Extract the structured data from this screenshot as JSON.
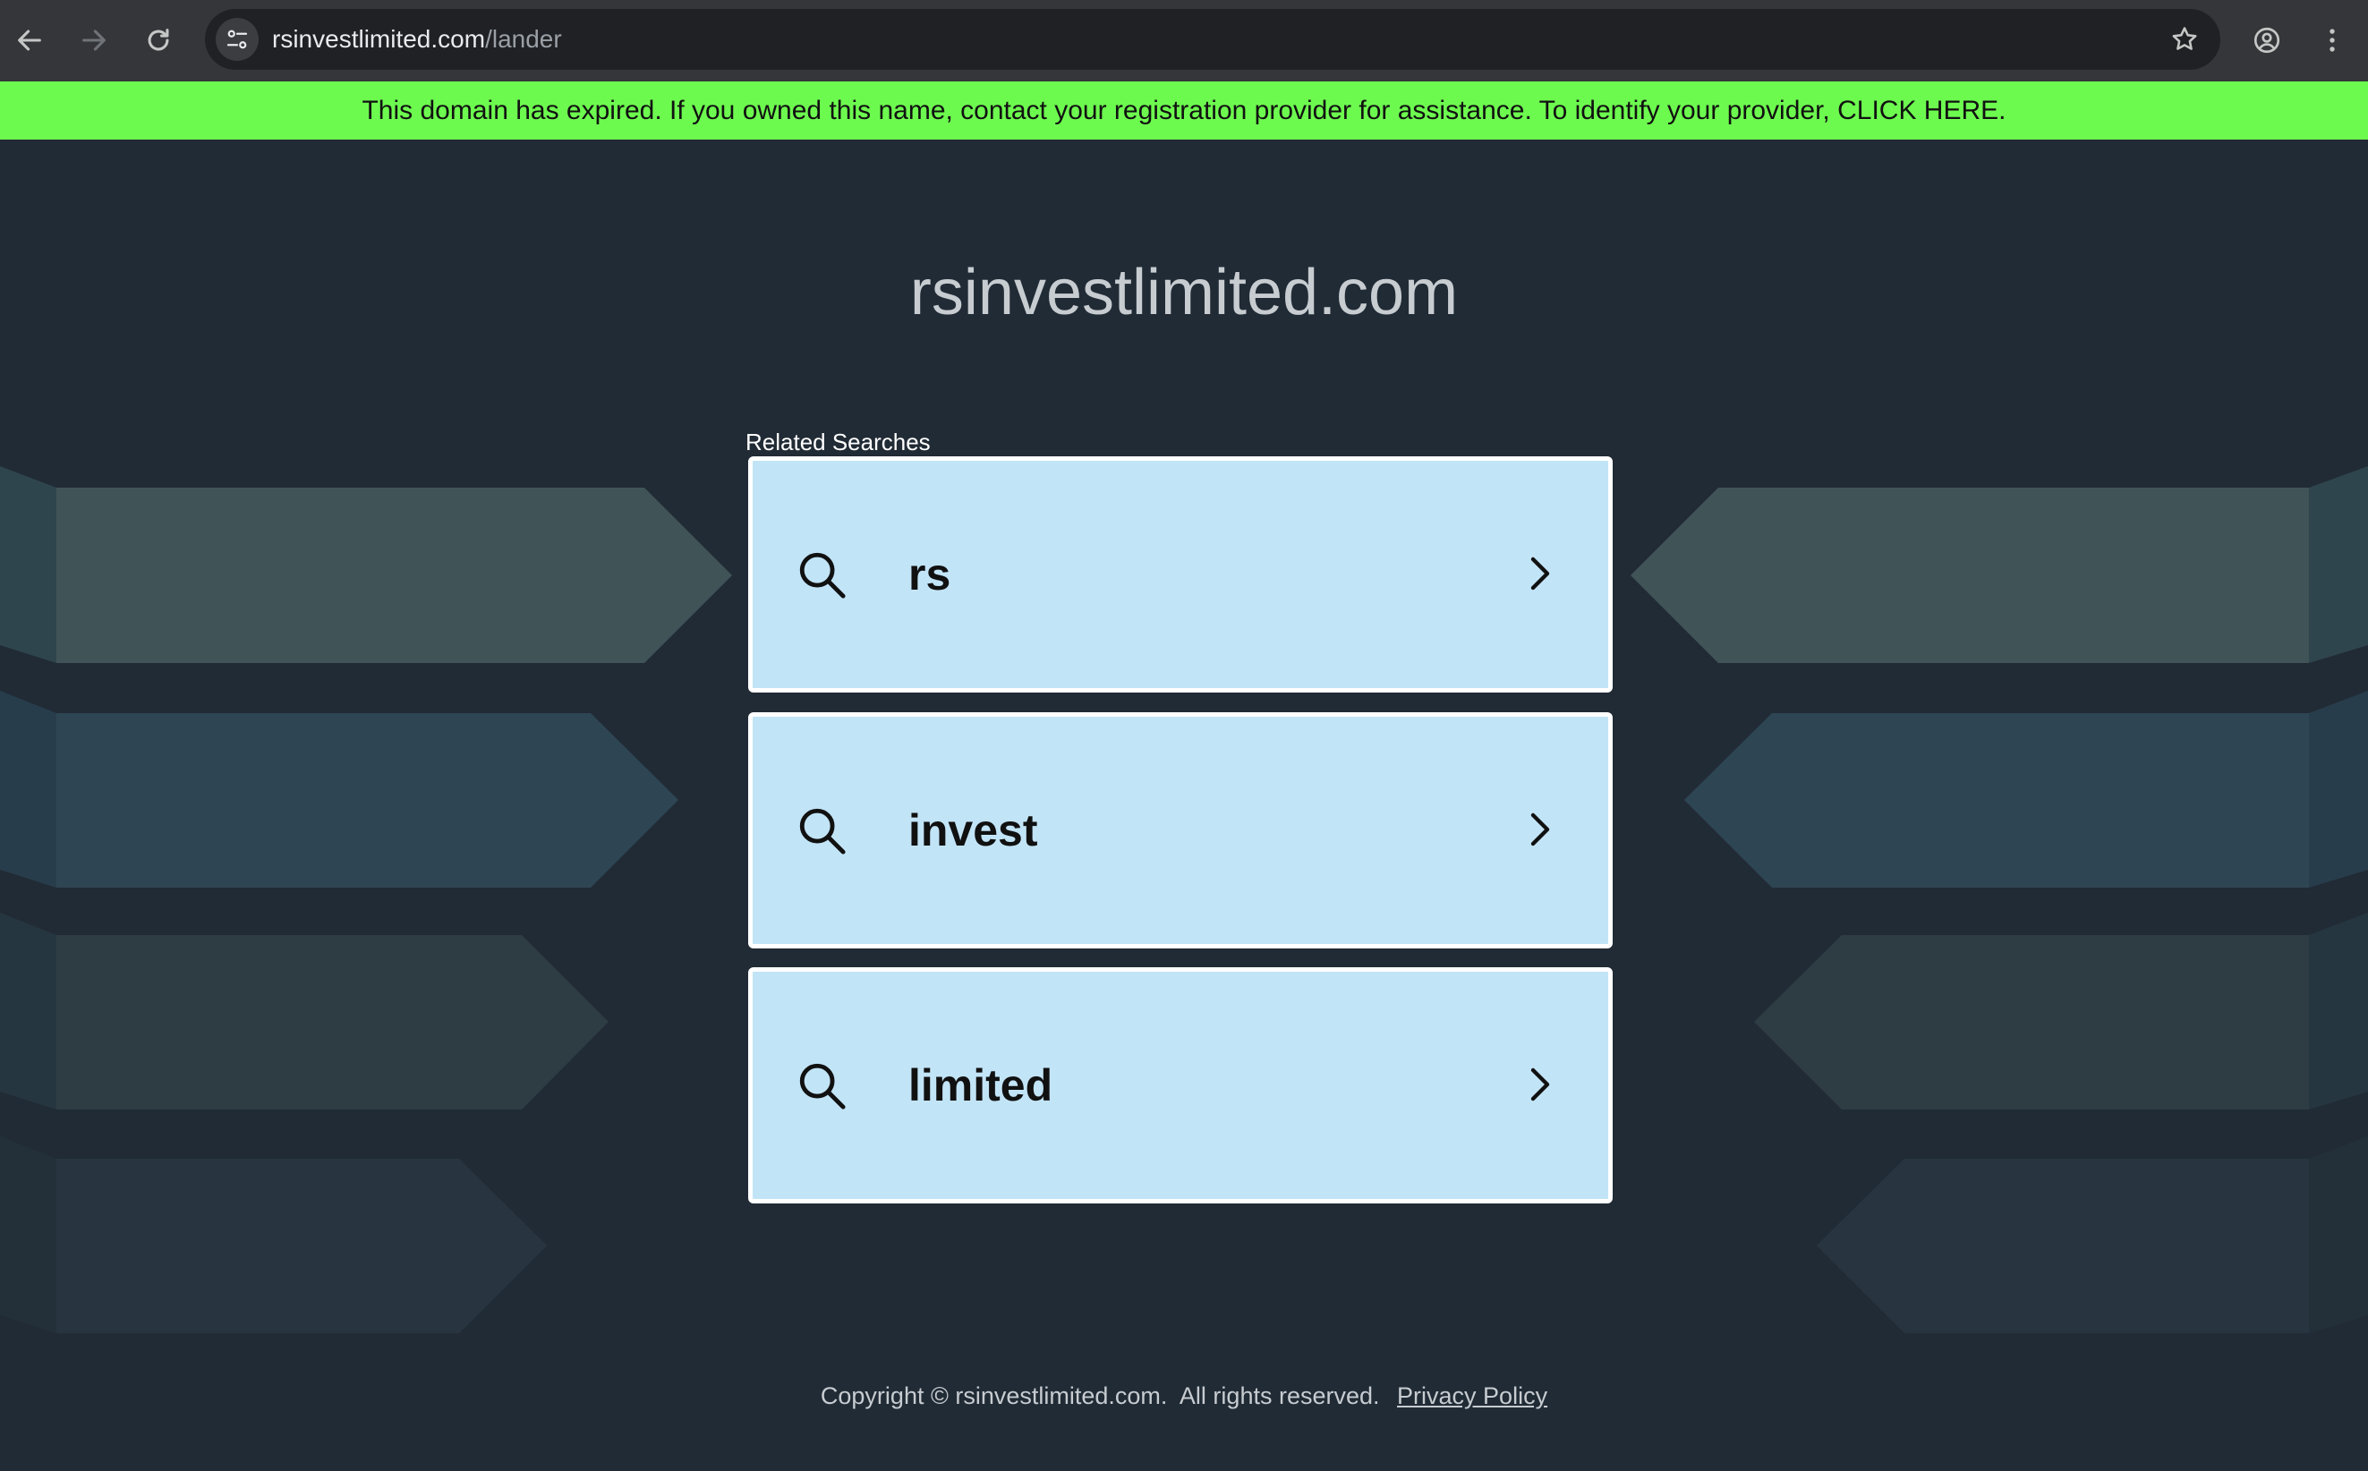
{
  "browser": {
    "url_domain": "rsinvestlimited.com",
    "url_path": "/lander",
    "icons": [
      "back-arrow-icon",
      "forward-arrow-icon",
      "reload-icon",
      "site-info-icon",
      "star-icon",
      "profile-icon",
      "more-vert-icon"
    ]
  },
  "banner": {
    "text": "This domain has expired. If you owned this name, contact your registration provider for assistance. To identify your provider,",
    "link": "CLICK HERE.",
    "color": "#6dfa4f"
  },
  "page": {
    "title": "rsinvestlimited.com",
    "related_label": "Related Searches",
    "searches": [
      {
        "label": "rs"
      },
      {
        "label": "invest"
      },
      {
        "label": "limited"
      }
    ],
    "background_color": "#212b35",
    "card_color": "#c2e4f7"
  },
  "footer": {
    "copyright": "Copyright © rsinvestlimited.com.  All rights reserved.",
    "privacy_link": "Privacy Policy"
  }
}
